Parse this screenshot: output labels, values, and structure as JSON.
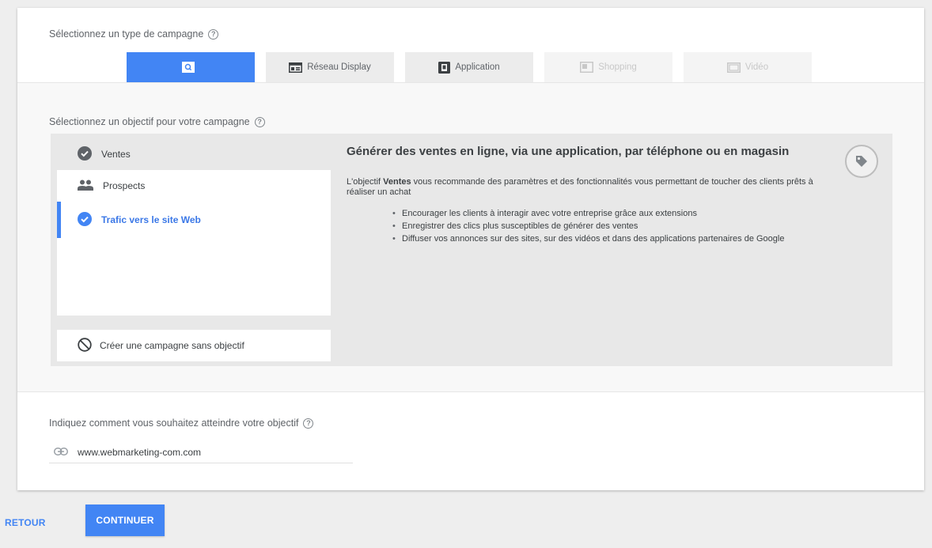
{
  "campaign_type": {
    "label": "Sélectionnez un type de campagne",
    "tabs": [
      {
        "label": "",
        "icon": "search-icon",
        "state": "active"
      },
      {
        "label": "Réseau Display",
        "icon": "display-icon",
        "state": "normal"
      },
      {
        "label": "Application",
        "icon": "app-icon",
        "state": "normal"
      },
      {
        "label": "Shopping",
        "icon": "shopping-icon",
        "state": "disabled"
      },
      {
        "label": "Vidéo",
        "icon": "video-icon",
        "state": "disabled"
      }
    ]
  },
  "objective": {
    "label": "Sélectionnez un objectif pour votre campagne",
    "items": [
      {
        "label": "Ventes",
        "icon": "check-circle-icon"
      },
      {
        "label": "Prospects",
        "icon": "people-icon"
      },
      {
        "label": "Trafic vers le site Web",
        "icon": "check-circle-icon"
      }
    ],
    "no_objective": "Créer une campagne sans objectif",
    "detail": {
      "title": "Générer des ventes en ligne, via une application, par téléphone ou en magasin",
      "desc_prefix": "L'objectif ",
      "desc_bold": "Ventes",
      "desc_suffix": " vous recommande des paramètres et des fonctionnalités vous permettant de toucher des clients prêts à réaliser un achat",
      "bullets": [
        "Encourager les clients à interagir avec votre entreprise grâce aux extensions",
        "Enregistrer des clics plus susceptibles de générer des ventes",
        "Diffuser vos annonces sur des sites, sur des vidéos et dans des applications partenaires de Google"
      ]
    }
  },
  "reach": {
    "label": "Indiquez comment vous souhaitez atteindre votre objectif",
    "url": "www.webmarketing-com.com"
  },
  "footer": {
    "back_label": "RETOUR",
    "continue_label": "CONTINUER"
  },
  "colors": {
    "accent": "#4285f4",
    "panel": "#e8e8e8"
  }
}
